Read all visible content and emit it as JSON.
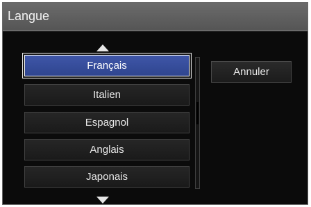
{
  "dialog": {
    "title": "Langue"
  },
  "language_list": {
    "items": [
      {
        "label": "Français",
        "selected": true
      },
      {
        "label": "Italien",
        "selected": false
      },
      {
        "label": "Espagnol",
        "selected": false
      },
      {
        "label": "Anglais",
        "selected": false
      },
      {
        "label": "Japonais",
        "selected": false
      }
    ]
  },
  "buttons": {
    "cancel_label": "Annuler"
  },
  "icons": {
    "scroll_up": "triangle-up-icon",
    "scroll_down": "triangle-down-icon"
  },
  "colors": {
    "selected_background": "#3f56a8",
    "dialog_background": "#0b0b0b",
    "title_bar": "#606060",
    "text": "#e8e8e8"
  }
}
